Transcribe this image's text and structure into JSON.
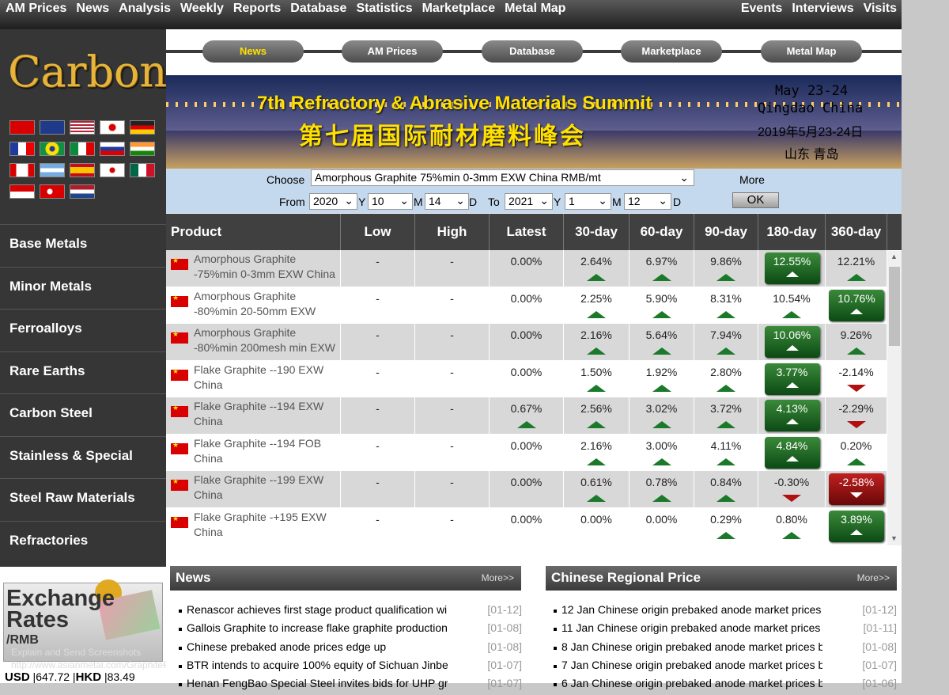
{
  "topnav": {
    "left": [
      "AM Prices",
      "News",
      "Analysis",
      "Weekly",
      "Reports",
      "Database",
      "Statistics",
      "Marketplace",
      "Metal Map"
    ],
    "right": [
      "Events",
      "Interviews",
      "Visits"
    ]
  },
  "logo": "Carbon",
  "flags": [
    "china",
    "uk",
    "usa",
    "japan",
    "germany",
    "france",
    "brazil",
    "italy",
    "russia",
    "india",
    "canada",
    "argentina",
    "spain",
    "korea",
    "mexico",
    "indonesia",
    "turkey",
    "netherlands"
  ],
  "sidebar": [
    "Base Metals",
    "Minor Metals",
    "Ferroalloys",
    "Rare Earths",
    "Carbon Steel",
    "Stainless & Special",
    "Steel Raw Materials",
    "Refractories"
  ],
  "exchange": {
    "title1": "Exchange",
    "title2": "Rates",
    "title3": "/RMB",
    "watermark1": "Explain and Send Screenshots",
    "watermark2": "http://www.asianmetal.com/GraphitePrice/Graphite.am",
    "usd_label": "USD",
    "usd": "647.72",
    "hkd_label": "HKD",
    "hkd": "83.49"
  },
  "tabs": [
    "News",
    "AM Prices",
    "Database",
    "Marketplace",
    "Metal Map"
  ],
  "active_tab": "News",
  "banner": {
    "en": "7th Refractory & Abrasive Materials Summit",
    "cn": "第七届国际耐材磨料峰会",
    "date_en": "May 23-24",
    "city_en": "Qingdao China",
    "date_cn": "2019年5月23-24日",
    "city_cn": "山东 青岛"
  },
  "filter": {
    "choose_label": "Choose",
    "choose_value": "Amorphous Graphite 75%min 0-3mm EXW China RMB/mt",
    "more": "More",
    "from_label": "From",
    "to_label": "To",
    "from_year": "2020",
    "from_month": "10",
    "from_day": "14",
    "to_year": "2021",
    "to_month": "1",
    "to_day": "12",
    "y": "Y",
    "m": "M",
    "d": "D",
    "ok": "OK"
  },
  "table": {
    "headers": [
      "Product",
      "Low",
      "High",
      "Latest",
      "30-day",
      "60-day",
      "90-day",
      "180-day",
      "360-day"
    ],
    "rows": [
      {
        "product": "Amorphous Graphite -75%min 0-3mm EXW China",
        "low": "-",
        "high": "-",
        "latest": "0.00%",
        "d30": "2.64%",
        "d60": "6.97%",
        "d90": "9.86%",
        "d180": "12.55%",
        "d360": "12.21%",
        "dir": [
          "",
          "up",
          "up",
          "up",
          "up",
          "up"
        ],
        "hl": [
          "",
          "",
          "",
          "",
          "g",
          ""
        ]
      },
      {
        "product": "Amorphous Graphite -80%min 20-50mm EXW China",
        "low": "-",
        "high": "-",
        "latest": "0.00%",
        "d30": "2.25%",
        "d60": "5.90%",
        "d90": "8.31%",
        "d180": "10.54%",
        "d360": "10.76%",
        "dir": [
          "",
          "up",
          "up",
          "up",
          "up",
          "up"
        ],
        "hl": [
          "",
          "",
          "",
          "",
          "",
          "g"
        ]
      },
      {
        "product": "Amorphous Graphite -80%min 200mesh min EXW China",
        "low": "-",
        "high": "-",
        "latest": "0.00%",
        "d30": "2.16%",
        "d60": "5.64%",
        "d90": "7.94%",
        "d180": "10.06%",
        "d360": "9.26%",
        "dir": [
          "",
          "up",
          "up",
          "up",
          "up",
          "up"
        ],
        "hl": [
          "",
          "",
          "",
          "",
          "g",
          ""
        ]
      },
      {
        "product": "Flake Graphite --190 EXW China",
        "low": "-",
        "high": "-",
        "latest": "0.00%",
        "d30": "1.50%",
        "d60": "1.92%",
        "d90": "2.80%",
        "d180": "3.77%",
        "d360": "-2.14%",
        "dir": [
          "",
          "up",
          "up",
          "up",
          "up",
          "dn"
        ],
        "hl": [
          "",
          "",
          "",
          "",
          "g",
          ""
        ]
      },
      {
        "product": "Flake Graphite --194 EXW China",
        "low": "-",
        "high": "-",
        "latest": "0.67%",
        "d30": "2.56%",
        "d60": "3.02%",
        "d90": "3.72%",
        "d180": "4.13%",
        "d360": "-2.29%",
        "dir": [
          "up",
          "up",
          "up",
          "up",
          "up",
          "dn"
        ],
        "hl": [
          "",
          "",
          "",
          "",
          "g",
          ""
        ]
      },
      {
        "product": "Flake Graphite --194 FOB China",
        "low": "-",
        "high": "-",
        "latest": "0.00%",
        "d30": "2.16%",
        "d60": "3.00%",
        "d90": "4.11%",
        "d180": "4.84%",
        "d360": "0.20%",
        "dir": [
          "",
          "up",
          "up",
          "up",
          "up",
          "up"
        ],
        "hl": [
          "",
          "",
          "",
          "",
          "g",
          ""
        ]
      },
      {
        "product": "Flake Graphite --199 EXW China",
        "low": "-",
        "high": "-",
        "latest": "0.00%",
        "d30": "0.61%",
        "d60": "0.78%",
        "d90": "0.84%",
        "d180": "-0.30%",
        "d360": "-2.58%",
        "dir": [
          "",
          "up",
          "up",
          "up",
          "dn",
          "dn"
        ],
        "hl": [
          "",
          "",
          "",
          "",
          "",
          "r"
        ]
      },
      {
        "product": "Flake Graphite -+195 EXW China",
        "low": "-",
        "high": "-",
        "latest": "0.00%",
        "d30": "0.00%",
        "d60": "0.00%",
        "d90": "0.29%",
        "d180": "0.80%",
        "d360": "3.89%",
        "dir": [
          "",
          "",
          "",
          "up",
          "up",
          "up"
        ],
        "hl": [
          "",
          "",
          "",
          "",
          "",
          "g"
        ]
      }
    ]
  },
  "news": {
    "title": "News",
    "more": "More>>",
    "items": [
      {
        "t": "Renascor achieves first stage product qualification wi",
        "d": "[01-12]"
      },
      {
        "t": "Gallois Graphite to increase flake graphite production",
        "d": "[01-08]"
      },
      {
        "t": "Chinese prebaked anode prices edge up",
        "d": "[01-08]"
      },
      {
        "t": "BTR intends to acquire 100% equity of Sichuan Jinbe",
        "d": "[01-07]"
      },
      {
        "t": "Henan FengBao Special Steel invites bids for UHP gr",
        "d": "[01-07]"
      }
    ]
  },
  "regional": {
    "title": "Chinese Regional Price",
    "more": "More>>",
    "items": [
      {
        "t": "12 Jan Chinese origin prebaked anode market prices",
        "d": "[01-12]"
      },
      {
        "t": "11 Jan Chinese origin prebaked anode market prices",
        "d": "[01-11]"
      },
      {
        "t": "8 Jan Chinese origin prebaked anode market prices b",
        "d": "[01-08]"
      },
      {
        "t": "7 Jan Chinese origin prebaked anode market prices b",
        "d": "[01-07]"
      },
      {
        "t": "6 Jan Chinese origin prebaked anode market prices b",
        "d": "[01-06]"
      }
    ]
  },
  "colors": {
    "up": "#1a7a2a",
    "down": "#b01010",
    "active_tab": "#ffe000",
    "header": "#404040"
  }
}
